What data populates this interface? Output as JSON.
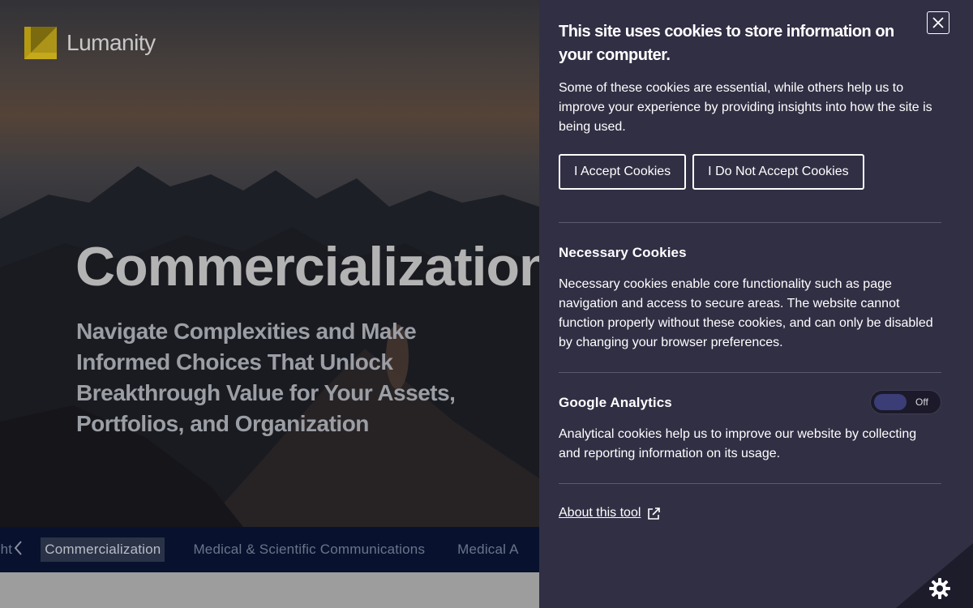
{
  "site": {
    "logo_text": "Lumanity",
    "hero_title": "Commercialization",
    "hero_subtitle": "Navigate Complexities and Make Informed Choices That Unlock Breakthrough Value for Your Assets, Portfolios, and Organization",
    "tabs": [
      {
        "label": "ight"
      },
      {
        "label": "Commercialization"
      },
      {
        "label": "Medical & Scientific Communications"
      },
      {
        "label": "Medical A"
      }
    ],
    "prev_icon": "chevron-left-icon"
  },
  "cookie_panel": {
    "title": "This site uses cookies to store information on your computer.",
    "intro": "Some of these cookies are essential, while others help us to improve your experience by providing insights into how the site is being used.",
    "accept_label": "I Accept Cookies",
    "decline_label": "I Do Not Accept Cookies",
    "necessary_title": "Necessary Cookies",
    "necessary_text": "Necessary cookies enable core functionality such as page navigation and access to secure areas. The website cannot function properly without these cookies, and can only be disabled by changing your browser preferences.",
    "analytics_title": "Google Analytics",
    "analytics_toggle_label": "Off",
    "analytics_text": "Analytical cookies help us to improve our website by collecting and reporting information on its usage.",
    "about_label": "About this tool",
    "close_icon": "close-icon",
    "external_icon": "external-link-icon",
    "settings_icon": "gear-icon"
  },
  "colors": {
    "panel_bg": "#312f44",
    "tabs_bg": "#08122e",
    "logo_accent": "#b39a12",
    "toggle_knob": "#3b3d76"
  }
}
